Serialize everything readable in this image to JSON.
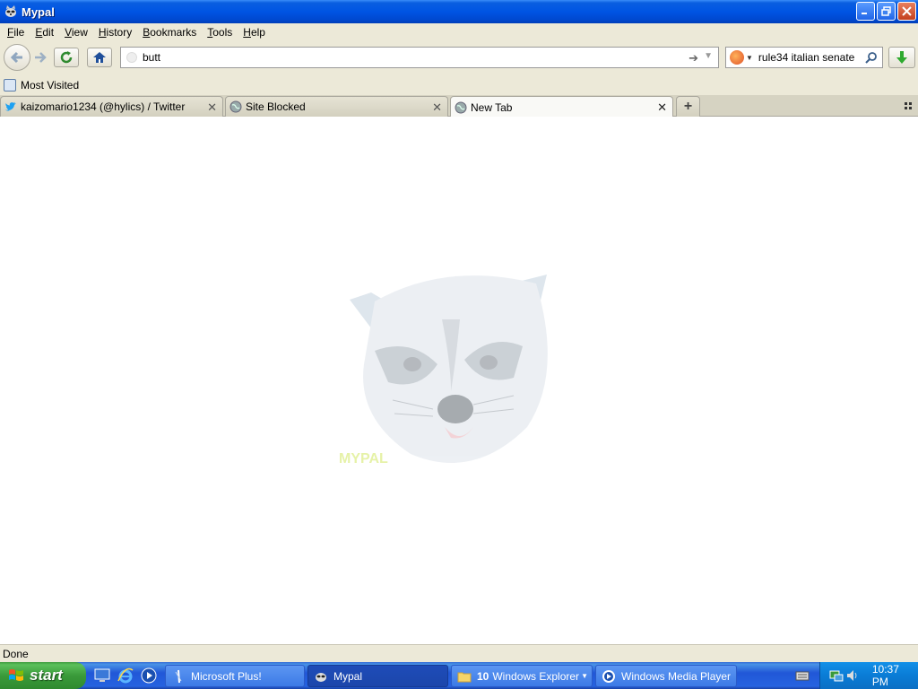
{
  "window": {
    "title": "Mypal",
    "app_icon": "raccoon-icon"
  },
  "menu": [
    {
      "label": "File",
      "accel": "F"
    },
    {
      "label": "Edit",
      "accel": "E"
    },
    {
      "label": "View",
      "accel": "V"
    },
    {
      "label": "History",
      "accel": "H"
    },
    {
      "label": "Bookmarks",
      "accel": "B"
    },
    {
      "label": "Tools",
      "accel": "T"
    },
    {
      "label": "Help",
      "accel": "H"
    }
  ],
  "menu_labels": {
    "file_rest": "ile",
    "edit_rest": "dit",
    "view_rest": "iew",
    "history_rest": "istory",
    "bookmarks_rest": "ookmarks",
    "tools_rest": "ools",
    "help_rest": "elp",
    "file_a": "F",
    "edit_a": "E",
    "view_a": "V",
    "history_a": "H",
    "bookmarks_a": "B",
    "tools_a": "T",
    "help_a": "H"
  },
  "navigation": {
    "url_value": "butt",
    "search_value": "rule34 italian senate"
  },
  "bookmarks_toolbar": {
    "most_visited": "Most Visited"
  },
  "tabs": [
    {
      "label": "kaizomario1234 (@hylics) / Twitter",
      "icon": "twitter-bird-icon",
      "active": false
    },
    {
      "label": "Site Blocked",
      "icon": "globe-icon",
      "active": false
    },
    {
      "label": "New Tab",
      "icon": "globe-icon",
      "active": true
    }
  ],
  "content": {
    "logo_text": "MYPAL"
  },
  "status": {
    "text": "Done"
  },
  "taskbar": {
    "start_label": "start",
    "tasks": [
      {
        "label": "Microsoft Plus!",
        "icon": "plus-icon",
        "active": false
      },
      {
        "label": "Mypal",
        "icon": "raccoon-icon",
        "active": true
      },
      {
        "label": "Windows Explorer",
        "count": "10",
        "icon": "folder-icon",
        "active": false
      },
      {
        "label": "Windows Media Player",
        "icon": "media-player-icon",
        "active": false
      }
    ],
    "clock": "10:37 PM"
  },
  "colors": {
    "titlebar_blue": "#0054e3",
    "chrome_beige": "#ece9d8",
    "taskbar_blue": "#245edb",
    "start_green": "#3c9a3c",
    "tray_blue": "#0b7cd6"
  }
}
